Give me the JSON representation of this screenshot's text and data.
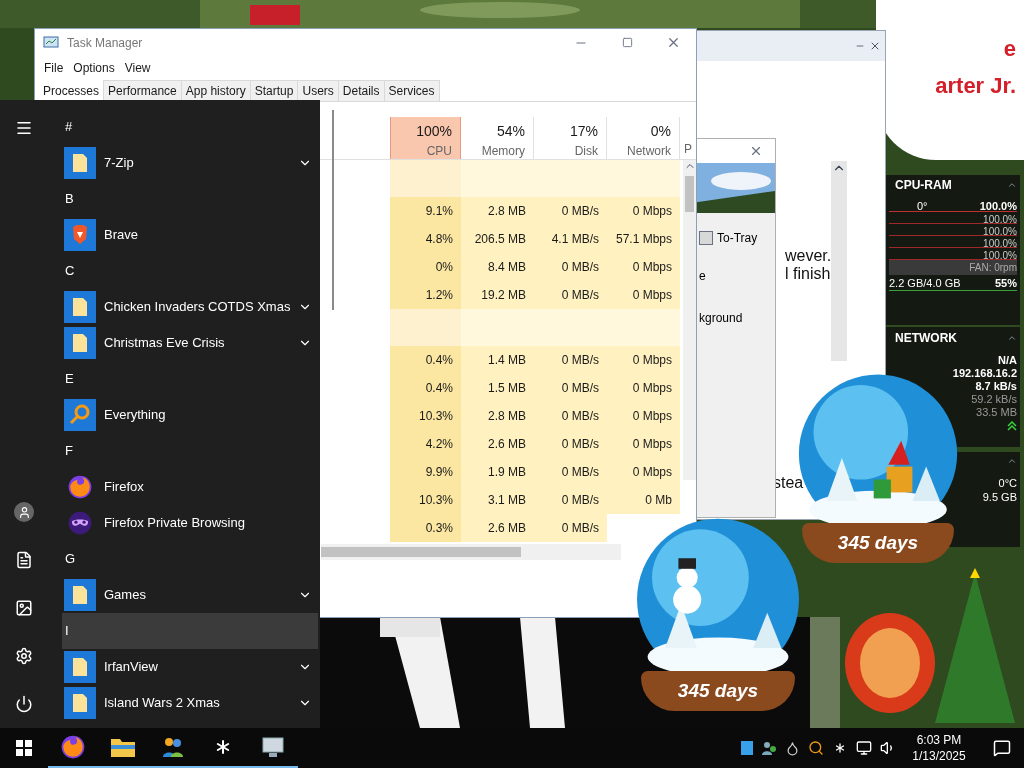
{
  "task_manager": {
    "title": "Task Manager",
    "menu": [
      "File",
      "Options",
      "View"
    ],
    "tabs": [
      {
        "label": "Processes",
        "selected": true
      },
      {
        "label": "Performance",
        "selected": false
      },
      {
        "label": "App history",
        "selected": false
      },
      {
        "label": "Startup",
        "selected": false
      },
      {
        "label": "Users",
        "selected": false
      },
      {
        "label": "Details",
        "selected": false
      },
      {
        "label": "Services",
        "selected": false
      }
    ],
    "columns": [
      {
        "percent": "100%",
        "label": "CPU",
        "highlighted": true
      },
      {
        "percent": "54%",
        "label": "Memory",
        "highlighted": false
      },
      {
        "percent": "17%",
        "label": "Disk",
        "highlighted": false
      },
      {
        "percent": "0%",
        "label": "Network",
        "highlighted": false
      }
    ],
    "column_5": "P",
    "rows": [
      {
        "kind": "group"
      },
      {
        "kind": "process",
        "cells": [
          "9.1%",
          "2.8 MB",
          "0 MB/s",
          "0 Mbps"
        ]
      },
      {
        "kind": "process",
        "cells": [
          "4.8%",
          "206.5 MB",
          "4.1 MB/s",
          "57.1 Mbps"
        ]
      },
      {
        "kind": "process",
        "cells": [
          "0%",
          "8.4 MB",
          "0 MB/s",
          "0 Mbps"
        ]
      },
      {
        "kind": "process",
        "cells": [
          "1.2%",
          "19.2 MB",
          "0 MB/s",
          "0 Mbps"
        ]
      },
      {
        "kind": "group"
      },
      {
        "kind": "process",
        "cells": [
          "0.4%",
          "1.4 MB",
          "0 MB/s",
          "0 Mbps"
        ]
      },
      {
        "kind": "process",
        "cells": [
          "0.4%",
          "1.5 MB",
          "0 MB/s",
          "0 Mbps"
        ]
      },
      {
        "kind": "process",
        "cells": [
          "10.3%",
          "2.8 MB",
          "0 MB/s",
          "0 Mbps"
        ]
      },
      {
        "kind": "process",
        "cells": [
          "4.2%",
          "2.6 MB",
          "0 MB/s",
          "0 Mbps"
        ]
      },
      {
        "kind": "process",
        "cells": [
          "9.9%",
          "1.9 MB",
          "0 MB/s",
          "0 Mbps"
        ]
      },
      {
        "kind": "process",
        "cells": [
          "10.3%",
          "3.1 MB",
          "0 MB/s",
          "0 Mb"
        ]
      },
      {
        "kind": "process",
        "cells": [
          "0.3%",
          "2.6 MB",
          "0 MB/s"
        ]
      }
    ]
  },
  "start_menu": {
    "sections": [
      {
        "letter": "#",
        "selected": false,
        "apps": [
          {
            "name": "7-Zip",
            "kind": "folder",
            "expandable": true
          }
        ]
      },
      {
        "letter": "B",
        "selected": false,
        "apps": [
          {
            "name": "Brave",
            "kind": "brave",
            "expandable": false
          }
        ]
      },
      {
        "letter": "C",
        "selected": false,
        "apps": [
          {
            "name": "Chicken Invaders COTDS Xmas",
            "kind": "folder",
            "expandable": true
          },
          {
            "name": "Christmas Eve Crisis",
            "kind": "folder",
            "expandable": true
          }
        ]
      },
      {
        "letter": "E",
        "selected": false,
        "apps": [
          {
            "name": "Everything",
            "kind": "search",
            "expandable": false
          }
        ]
      },
      {
        "letter": "F",
        "selected": false,
        "apps": [
          {
            "name": "Firefox",
            "kind": "firefox",
            "expandable": false
          },
          {
            "name": "Firefox Private Browsing",
            "kind": "private",
            "expandable": false
          }
        ]
      },
      {
        "letter": "G",
        "selected": false,
        "apps": [
          {
            "name": "Games",
            "kind": "folder",
            "expandable": true
          }
        ]
      },
      {
        "letter": "I",
        "selected": true,
        "apps": [
          {
            "name": "IrfanView",
            "kind": "folder",
            "expandable": true
          },
          {
            "name": "Island Wars 2 Xmas",
            "kind": "folder",
            "expandable": true
          }
        ]
      }
    ]
  },
  "back_window": {
    "lines": [
      "wever.",
      "l finish"
    ],
    "line_3": "stea"
  },
  "dialog": {
    "checkbox": {
      "label": "To-Tray",
      "checked": false
    },
    "text_1": "e",
    "text_2": "kground"
  },
  "speech_bubble": {
    "text_1": "e",
    "text_2": "arter Jr."
  },
  "cpu_ram": {
    "title": "CPU-RAM",
    "temperature": "0°",
    "total": "100.0%",
    "cores": [
      "100.0%",
      "100.0%",
      "100.0%",
      "100.0%"
    ],
    "fan": "FAN: 0rpm",
    "memory": "2.2 GB/4.0 GB",
    "memory_percent": "55%"
  },
  "network": {
    "title": "NETWORK",
    "lines": [
      "N/A",
      "192.168.16.2",
      "8.7 kB/s",
      "59.2 kB/s",
      "33.5 MB"
    ]
  },
  "drive_gadget": {
    "lines": [
      "0°C",
      "9.5 GB"
    ]
  },
  "globes": [
    {
      "label": "345 days"
    },
    {
      "label": "345 days"
    }
  ],
  "taskbar": {
    "time": "6:03 PM",
    "date": "1/13/2025"
  }
}
